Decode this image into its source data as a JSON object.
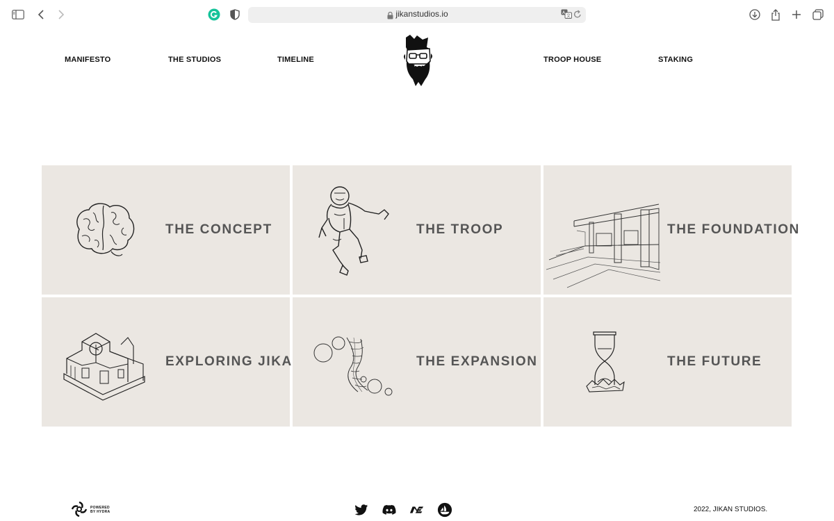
{
  "browser": {
    "url": "jikanstudios.io",
    "icons": [
      "sidebar-icon",
      "back-icon",
      "forward-icon",
      "grammarly-icon",
      "shield-icon",
      "lock-icon",
      "translate-icon",
      "reload-icon",
      "download-icon",
      "share-icon",
      "new-tab-icon",
      "tabs-overview-icon"
    ]
  },
  "nav": {
    "items": [
      "MANIFESTO",
      "THE STUDIOS",
      "TIMELINE",
      "TROOP HOUSE",
      "STAKING"
    ],
    "logo_icon": "bearded-man-logo-icon"
  },
  "cards": [
    {
      "label": "THE CONCEPT",
      "icon": "brain-icon"
    },
    {
      "label": "THE TROOP",
      "icon": "running-figure-icon"
    },
    {
      "label": "THE FOUNDATION",
      "icon": "temple-interior-icon"
    },
    {
      "label": "EXPLORING JIKAN",
      "icon": "clock-house-icon"
    },
    {
      "label": "THE EXPANSION",
      "icon": "wormhole-icon"
    },
    {
      "label": "THE FUTURE",
      "icon": "hourglass-icon"
    }
  ],
  "footer": {
    "powered_by": "POWERED BY HYDRA",
    "social_icons": [
      "twitter-icon",
      "discord-icon",
      "magic-eden-icon",
      "opensea-icon"
    ],
    "copyright": "2022, JIKAN STUDIOS."
  },
  "colors": {
    "card_bg": "#ebe7e2",
    "card_text": "#555555",
    "nav_text": "#111111",
    "grammarly_green": "#15c39a"
  }
}
